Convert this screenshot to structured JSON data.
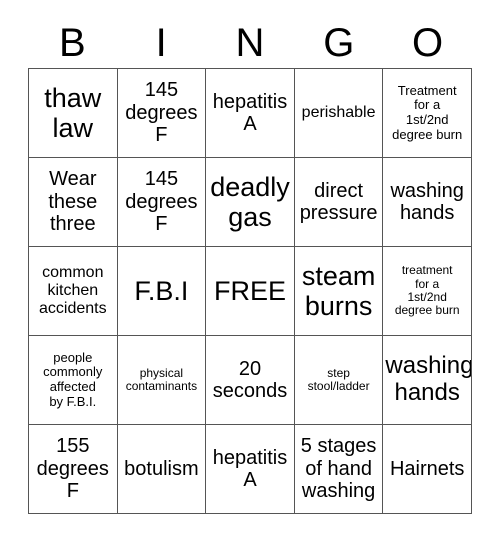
{
  "header": {
    "letters": [
      "B",
      "I",
      "N",
      "G",
      "O"
    ]
  },
  "grid": {
    "rows": [
      [
        {
          "text": "thaw\nlaw",
          "size": "fs-xl"
        },
        {
          "text": "145\ndegrees\nF",
          "size": "fs-md"
        },
        {
          "text": "hepatitis\nA",
          "size": "fs-md"
        },
        {
          "text": "perishable",
          "size": "fs-sm"
        },
        {
          "text": "Treatment\nfor a\n1st/2nd\ndegree burn",
          "size": "fs-xs"
        }
      ],
      [
        {
          "text": "Wear\nthese\nthree",
          "size": "fs-md"
        },
        {
          "text": "145\ndegrees\nF",
          "size": "fs-md"
        },
        {
          "text": "deadly\ngas",
          "size": "fs-xl"
        },
        {
          "text": "direct\npressure",
          "size": "fs-md"
        },
        {
          "text": "washing\nhands",
          "size": "fs-md"
        }
      ],
      [
        {
          "text": "common\nkitchen\naccidents",
          "size": "fs-sm"
        },
        {
          "text": "F.B.I",
          "size": "fs-xl"
        },
        {
          "text": "FREE",
          "size": "fs-xl"
        },
        {
          "text": "steam\nburns",
          "size": "fs-xl"
        },
        {
          "text": "treatment\nfor a\n1st/2nd\ndegree burn",
          "size": "fs-xxs"
        }
      ],
      [
        {
          "text": "people\ncommonly\naffected\nby F.B.I.",
          "size": "fs-xs"
        },
        {
          "text": "physical\ncontaminants",
          "size": "fs-xxs"
        },
        {
          "text": "20\nseconds",
          "size": "fs-md"
        },
        {
          "text": "step\nstool/ladder",
          "size": "fs-xxs"
        },
        {
          "text": "washing\nhands",
          "size": "fs-lg"
        }
      ],
      [
        {
          "text": "155\ndegrees\nF",
          "size": "fs-md"
        },
        {
          "text": "botulism",
          "size": "fs-md"
        },
        {
          "text": "hepatitis\nA",
          "size": "fs-md"
        },
        {
          "text": "5 stages\nof hand\nwashing",
          "size": "fs-md"
        },
        {
          "text": "Hairnets",
          "size": "fs-md"
        }
      ]
    ]
  },
  "colors": {
    "background": "#ffffff",
    "text": "#000000",
    "grid_line": "#555555"
  }
}
